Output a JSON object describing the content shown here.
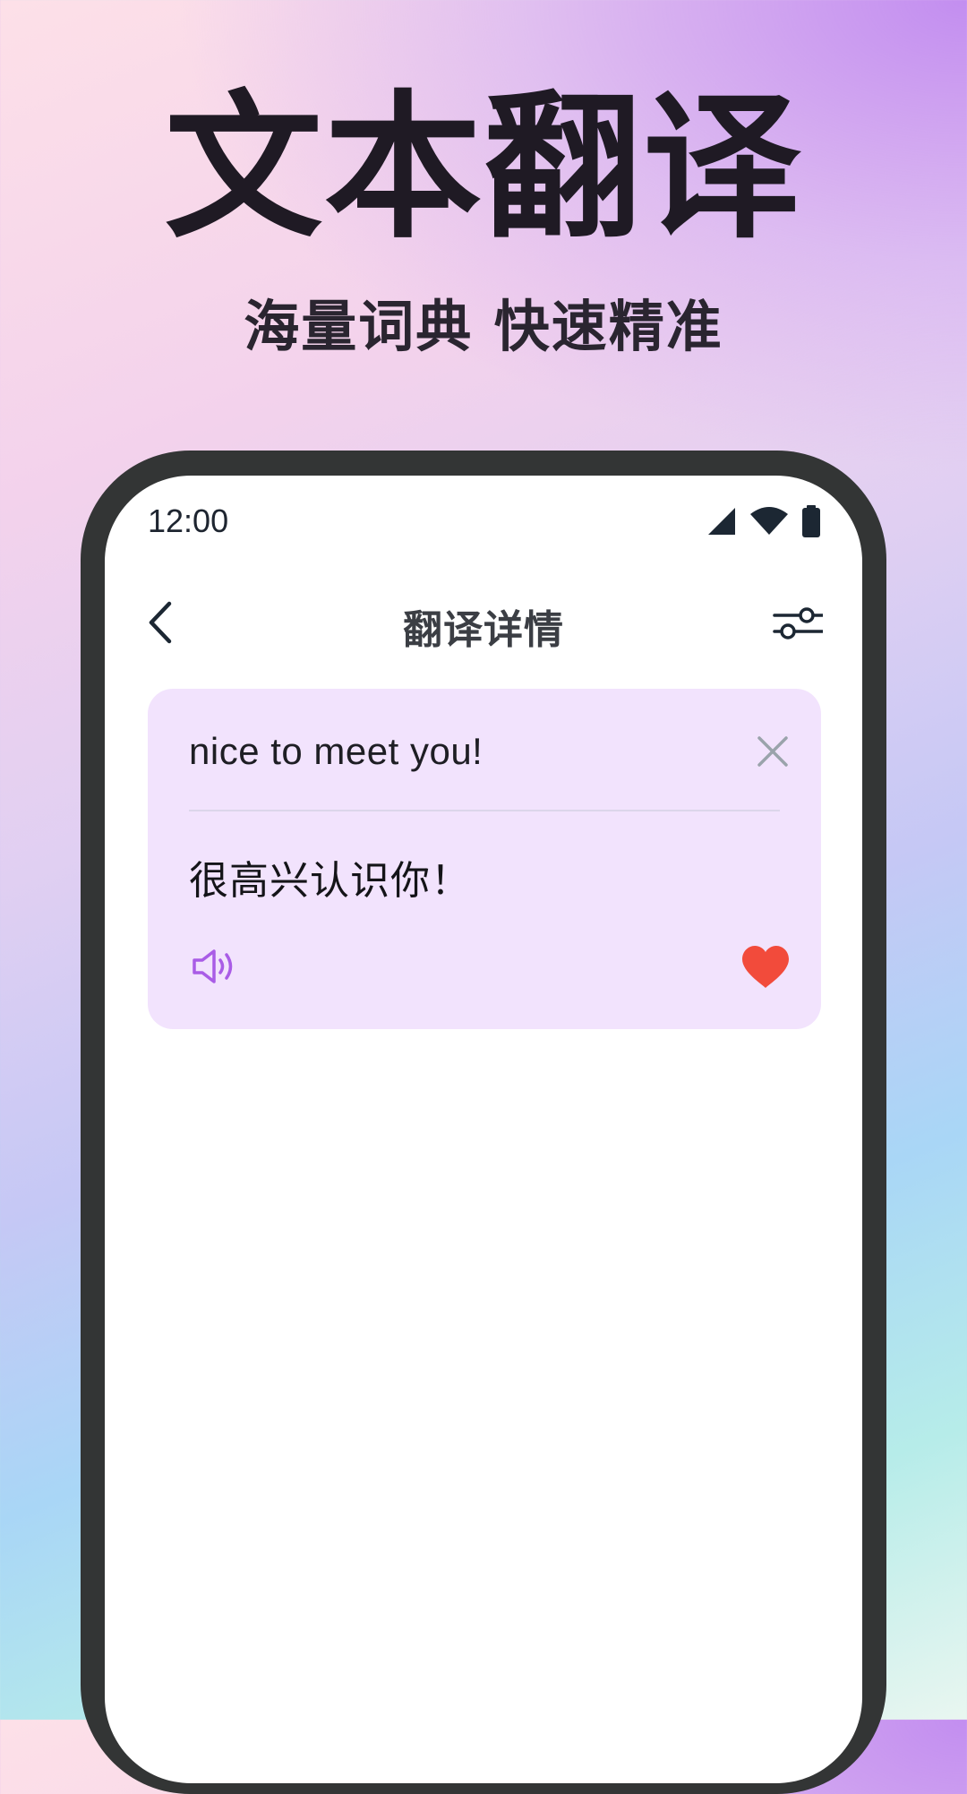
{
  "promo": {
    "headline": "文本翻译",
    "subline": "海量词典 快速精准"
  },
  "status_bar": {
    "time": "12:00",
    "icons": [
      "cellular-signal-icon",
      "wifi-icon",
      "battery-icon"
    ]
  },
  "nav": {
    "title": "翻译详情",
    "back_icon": "chevron-left-icon",
    "settings_icon": "sliders-icon"
  },
  "translation": {
    "source_text": "nice to meet you!",
    "target_text": "很高兴认识你！",
    "clear_icon": "close-icon",
    "speak_icon": "speaker-icon",
    "favorite_icon": "heart-icon",
    "favorited": true
  },
  "colors": {
    "card_background": "#f2e3fd",
    "speaker_accent": "#a95ce6",
    "favorite_heart": "#f24b3b",
    "phone_frame": "#333535"
  }
}
